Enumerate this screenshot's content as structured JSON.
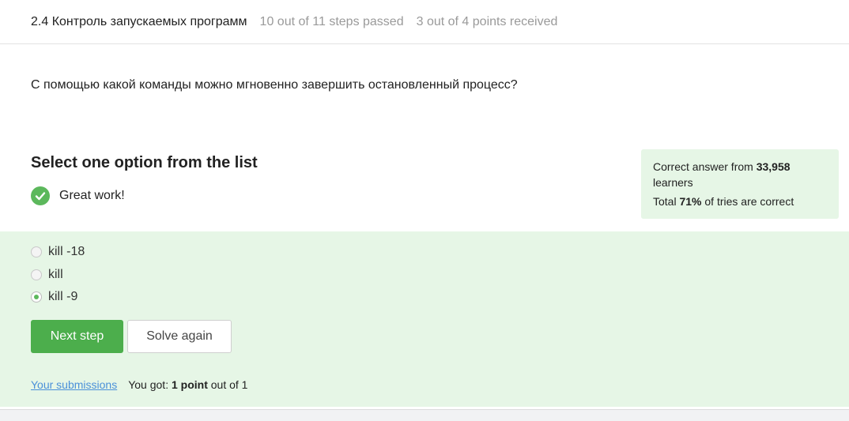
{
  "header": {
    "title": "2.4 Контроль запускаемых программ",
    "steps": "10 out of 11 steps passed",
    "points": "3 out of 4 points  received"
  },
  "question": "С помощью какой команды можно мгновенно завершить остановленный процесс?",
  "task": {
    "heading": "Select one option from the list",
    "status": "Great work!"
  },
  "stats": {
    "prefix": "Correct answer from ",
    "learners_count": "33,958",
    "learners_suffix": "learners",
    "total_prefix": "Total ",
    "percent": "71%",
    "total_suffix": " of tries are correct"
  },
  "options": [
    {
      "label": "kill -18",
      "checked": false
    },
    {
      "label": "kill",
      "checked": false
    },
    {
      "label": "kill -9",
      "checked": true
    }
  ],
  "buttons": {
    "next": "Next step",
    "solve_again": "Solve again"
  },
  "footer": {
    "submissions_link": "Your submissions",
    "got_prefix": "You got: ",
    "got_bold": "1 point",
    "got_suffix": " out of 1"
  },
  "colors": {
    "accent_green": "#4cae4c",
    "success_bg": "#e6f6e6",
    "link": "#4a90d9"
  },
  "icons": {
    "status": "check-circle-icon"
  }
}
